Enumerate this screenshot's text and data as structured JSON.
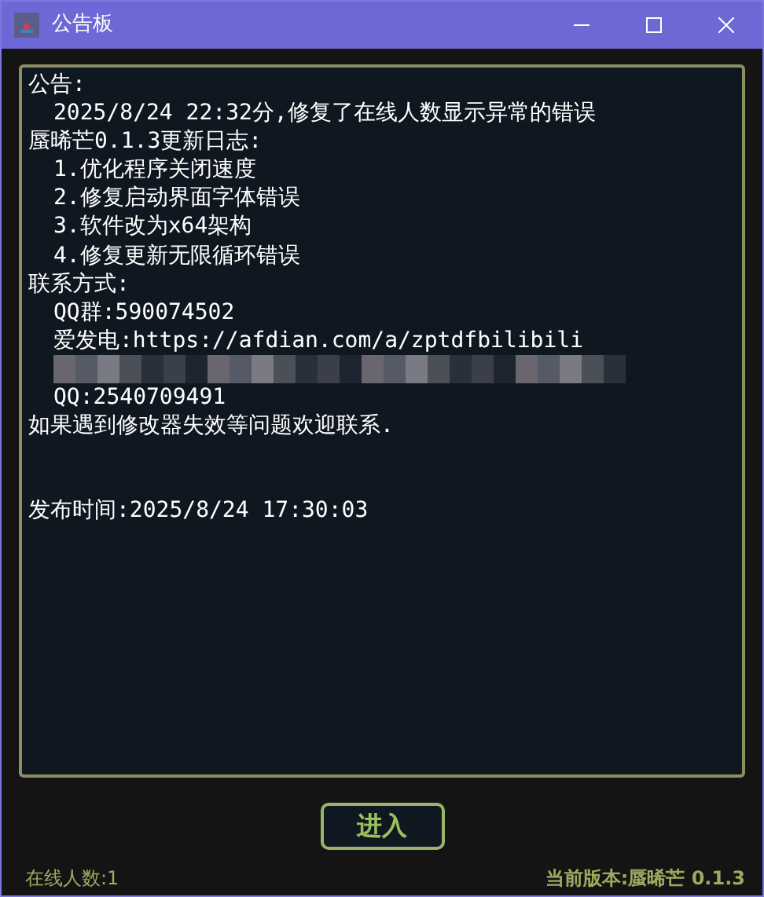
{
  "window": {
    "title": "公告板"
  },
  "notice": [
    {
      "text": "公告:",
      "children": [
        {
          "text": "2025/8/24 22:32分,修复了在线人数显示异常的错误"
        }
      ]
    },
    {
      "text": "蜃晞芒0.1.3更新日志:",
      "children": [
        {
          "text": "1.优化程序关闭速度"
        },
        {
          "text": "2.修复启动界面字体错误"
        },
        {
          "text": "3.软件改为x64架构"
        },
        {
          "text": "4.修复更新无限循环错误"
        }
      ]
    },
    {
      "text": "联系方式:",
      "children": [
        {
          "text": "QQ群:590074502"
        },
        {
          "text": "爱发电:https://afdian.com/a/zptdfbilibili"
        },
        {
          "kind": "redacted"
        },
        {
          "text": "QQ:2540709491"
        }
      ]
    },
    {
      "text": "如果遇到修改器失效等问题欢迎联系."
    },
    {
      "text": "发布时间:2025/8/24 17:30:03",
      "kind": "footer"
    }
  ],
  "enter_button": "进入",
  "status_bar": {
    "online": "在线人数:1",
    "version": "当前版本:蜃晞芒 0.1.3"
  }
}
